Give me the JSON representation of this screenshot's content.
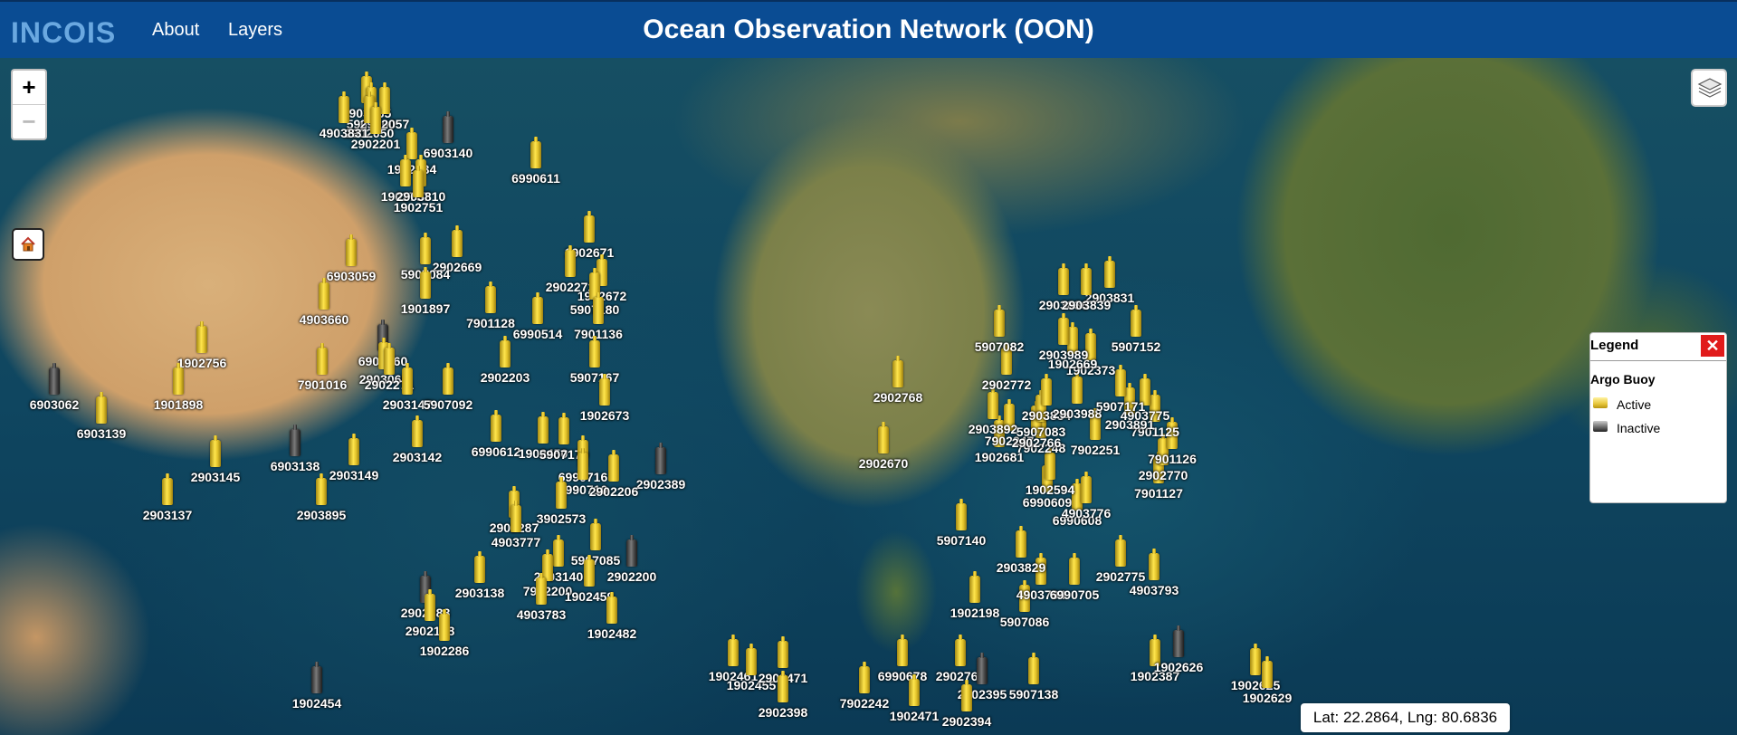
{
  "header": {
    "logo_text": "INCOIS",
    "nav": {
      "about": "About",
      "layers": "Layers"
    },
    "title": "Ocean Observation Network (OON)"
  },
  "map": {
    "zoom_in_label": "+",
    "zoom_out_label": "−",
    "buoys": [
      {
        "id": "2903955",
        "status": "active"
      },
      {
        "id": "5907100",
        "status": "active"
      },
      {
        "id": "2902057",
        "status": "active"
      },
      {
        "id": "2902050",
        "status": "active"
      },
      {
        "id": "4903831",
        "status": "active"
      },
      {
        "id": "6903140",
        "status": "inactive"
      },
      {
        "id": "2902201",
        "status": "active"
      },
      {
        "id": "6990611",
        "status": "active"
      },
      {
        "id": "1902734",
        "status": "active"
      },
      {
        "id": "1902757",
        "status": "active"
      },
      {
        "id": "2903810",
        "status": "active"
      },
      {
        "id": "1902751",
        "status": "active"
      },
      {
        "id": "1902671",
        "status": "active"
      },
      {
        "id": "6903059",
        "status": "active"
      },
      {
        "id": "2902669",
        "status": "active"
      },
      {
        "id": "5907084",
        "status": "active"
      },
      {
        "id": "2902272",
        "status": "active"
      },
      {
        "id": "1902672",
        "status": "active"
      },
      {
        "id": "1901897",
        "status": "active"
      },
      {
        "id": "5907180",
        "status": "active"
      },
      {
        "id": "4903660",
        "status": "active"
      },
      {
        "id": "7901128",
        "status": "active"
      },
      {
        "id": "6990514",
        "status": "active"
      },
      {
        "id": "7901136",
        "status": "active"
      },
      {
        "id": "1902756",
        "status": "active"
      },
      {
        "id": "6903060",
        "status": "inactive"
      },
      {
        "id": "2903060",
        "status": "active"
      },
      {
        "id": "2902203",
        "status": "active"
      },
      {
        "id": "5907167",
        "status": "active"
      },
      {
        "id": "7901016",
        "status": "active"
      },
      {
        "id": "2902271",
        "status": "active"
      },
      {
        "id": "6903062",
        "status": "inactive"
      },
      {
        "id": "1901898",
        "status": "active"
      },
      {
        "id": "2903147",
        "status": "active"
      },
      {
        "id": "5907092",
        "status": "active"
      },
      {
        "id": "1902673",
        "status": "active"
      },
      {
        "id": "6903139",
        "status": "active"
      },
      {
        "id": "6990612",
        "status": "active"
      },
      {
        "id": "1902450",
        "status": "active"
      },
      {
        "id": "5907179",
        "status": "active"
      },
      {
        "id": "6903138",
        "status": "inactive"
      },
      {
        "id": "2903142",
        "status": "active"
      },
      {
        "id": "2903145",
        "status": "active"
      },
      {
        "id": "2903149",
        "status": "active"
      },
      {
        "id": "6990716",
        "status": "active"
      },
      {
        "id": "2902389",
        "status": "inactive"
      },
      {
        "id": "6990710",
        "status": "active"
      },
      {
        "id": "2902206",
        "status": "active"
      },
      {
        "id": "2903137",
        "status": "active"
      },
      {
        "id": "2903895",
        "status": "active"
      },
      {
        "id": "3902573",
        "status": "active"
      },
      {
        "id": "2902287",
        "status": "active"
      },
      {
        "id": "4903777",
        "status": "active"
      },
      {
        "id": "5907085",
        "status": "active"
      },
      {
        "id": "2903140",
        "status": "active"
      },
      {
        "id": "2902200",
        "status": "inactive"
      },
      {
        "id": "7902200",
        "status": "active"
      },
      {
        "id": "2903138",
        "status": "active"
      },
      {
        "id": "1902459",
        "status": "active"
      },
      {
        "id": "2902388",
        "status": "inactive"
      },
      {
        "id": "4903783",
        "status": "active"
      },
      {
        "id": "2902198",
        "status": "active"
      },
      {
        "id": "1902482",
        "status": "active"
      },
      {
        "id": "1902286",
        "status": "active"
      },
      {
        "id": "1902454",
        "status": "inactive"
      },
      {
        "id": "1902461",
        "status": "active"
      },
      {
        "id": "1902455",
        "status": "active"
      },
      {
        "id": "2902471",
        "status": "active"
      },
      {
        "id": "2902398",
        "status": "active"
      },
      {
        "id": "7902242",
        "status": "active"
      },
      {
        "id": "6990678",
        "status": "active"
      },
      {
        "id": "2902764",
        "status": "active"
      },
      {
        "id": "2902395",
        "status": "inactive"
      },
      {
        "id": "5907138",
        "status": "active"
      },
      {
        "id": "1902198",
        "status": "active"
      },
      {
        "id": "5907086",
        "status": "active"
      },
      {
        "id": "4903794",
        "status": "active"
      },
      {
        "id": "6990705",
        "status": "active"
      },
      {
        "id": "2902775",
        "status": "active"
      },
      {
        "id": "4903793",
        "status": "active"
      },
      {
        "id": "2903829",
        "status": "active"
      },
      {
        "id": "5907140",
        "status": "active"
      },
      {
        "id": "6990609",
        "status": "active"
      },
      {
        "id": "6990608",
        "status": "active"
      },
      {
        "id": "4903776",
        "status": "active"
      },
      {
        "id": "7901127",
        "status": "active"
      },
      {
        "id": "2902770",
        "status": "active"
      },
      {
        "id": "7901126",
        "status": "active"
      },
      {
        "id": "1902594",
        "status": "active"
      },
      {
        "id": "7902251",
        "status": "active"
      },
      {
        "id": "2902670",
        "status": "active"
      },
      {
        "id": "1902681",
        "status": "active"
      },
      {
        "id": "7902248",
        "status": "active"
      },
      {
        "id": "7902247",
        "status": "active"
      },
      {
        "id": "2902766",
        "status": "active"
      },
      {
        "id": "2903892",
        "status": "active"
      },
      {
        "id": "5907083",
        "status": "active"
      },
      {
        "id": "2903834",
        "status": "active"
      },
      {
        "id": "2903988",
        "status": "active"
      },
      {
        "id": "7901125",
        "status": "active"
      },
      {
        "id": "2903891",
        "status": "active"
      },
      {
        "id": "4903775",
        "status": "active"
      },
      {
        "id": "5907171",
        "status": "active"
      },
      {
        "id": "2902772",
        "status": "active"
      },
      {
        "id": "2902768",
        "status": "active"
      },
      {
        "id": "1902373",
        "status": "active"
      },
      {
        "id": "1902669",
        "status": "active"
      },
      {
        "id": "2903989",
        "status": "active"
      },
      {
        "id": "5907082",
        "status": "active"
      },
      {
        "id": "5907152",
        "status": "active"
      },
      {
        "id": "2903831",
        "status": "active"
      },
      {
        "id": "2903836",
        "status": "active"
      },
      {
        "id": "2903839",
        "status": "active"
      },
      {
        "id": "1902387",
        "status": "active"
      },
      {
        "id": "1902626",
        "status": "inactive"
      },
      {
        "id": "1902625",
        "status": "active"
      },
      {
        "id": "1902629",
        "status": "active"
      },
      {
        "id": "1902471",
        "status": "active"
      },
      {
        "id": "2902394",
        "status": "active"
      }
    ]
  },
  "legend": {
    "title": "Legend",
    "close_label": "✕",
    "subtitle": "Argo Buoy",
    "items": [
      {
        "label": "Active",
        "status": "active"
      },
      {
        "label": "Inactive",
        "status": "inactive"
      }
    ]
  },
  "coordinates": {
    "text": "Lat: 22.2864, Lng: 80.6836"
  }
}
